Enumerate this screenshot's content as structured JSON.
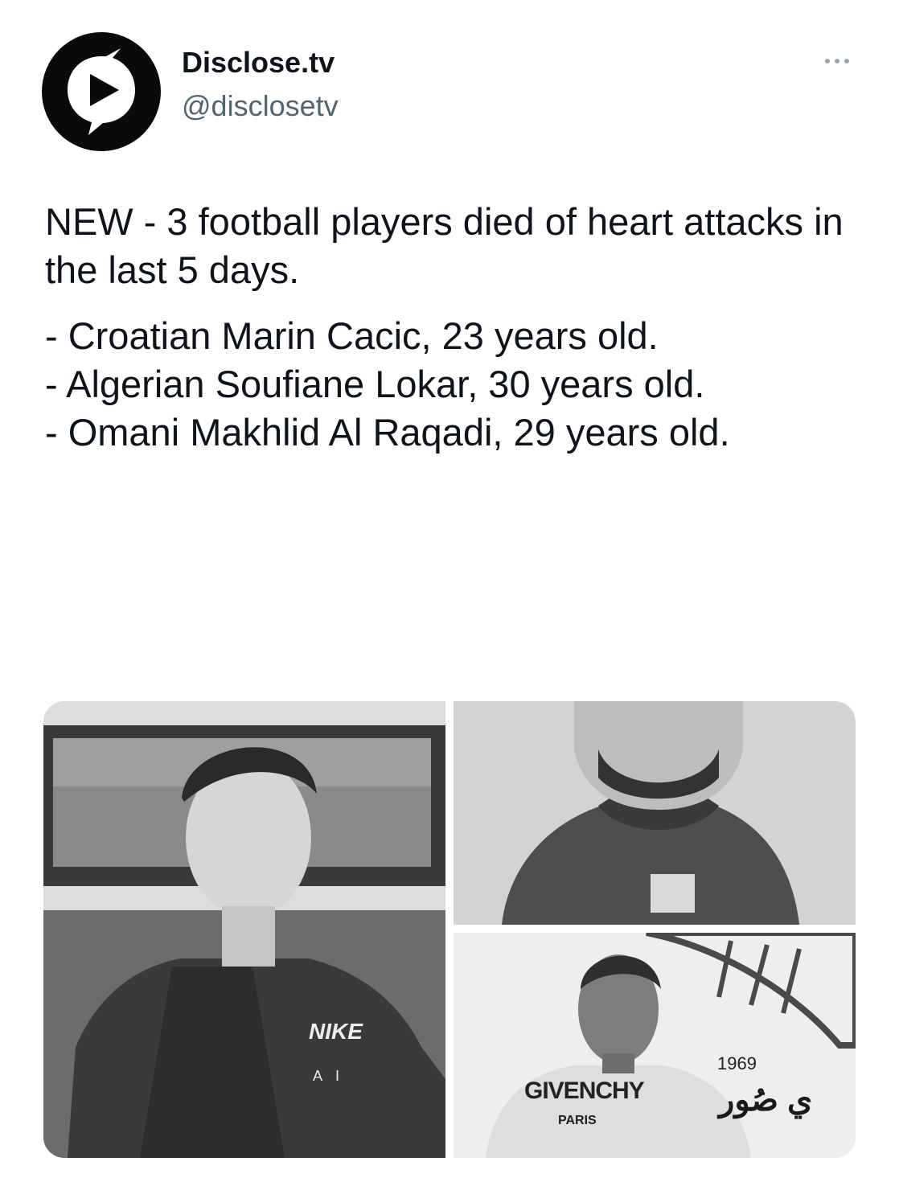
{
  "author": {
    "display_name": "Disclose.tv",
    "handle": "@disclosetv",
    "avatar_icon": "play-chat-bubble-icon"
  },
  "more_icon": "more-dots-icon",
  "tweet": {
    "paragraphs": [
      "NEW - 3 football players died of heart attacks in the last 5 days.",
      "- Croatian Marin Cacic, 23 years old.\n- Algerian Soufiane Lokar, 30 years old.\n- Omani Makhlid Al Raqadi, 29 years old."
    ]
  },
  "media": {
    "photos": [
      {
        "subject": "young man in dark hoodie",
        "print": "NIKE",
        "print2": "A I"
      },
      {
        "subject": "bearded man in team jersey"
      },
      {
        "subject": "man in white t-shirt",
        "print": "GIVENCHY",
        "print2": "PARIS",
        "year": "1969",
        "arabic": "ي صُور"
      }
    ]
  },
  "colors": {
    "text": "#0f1419",
    "secondary_text": "#536471"
  }
}
